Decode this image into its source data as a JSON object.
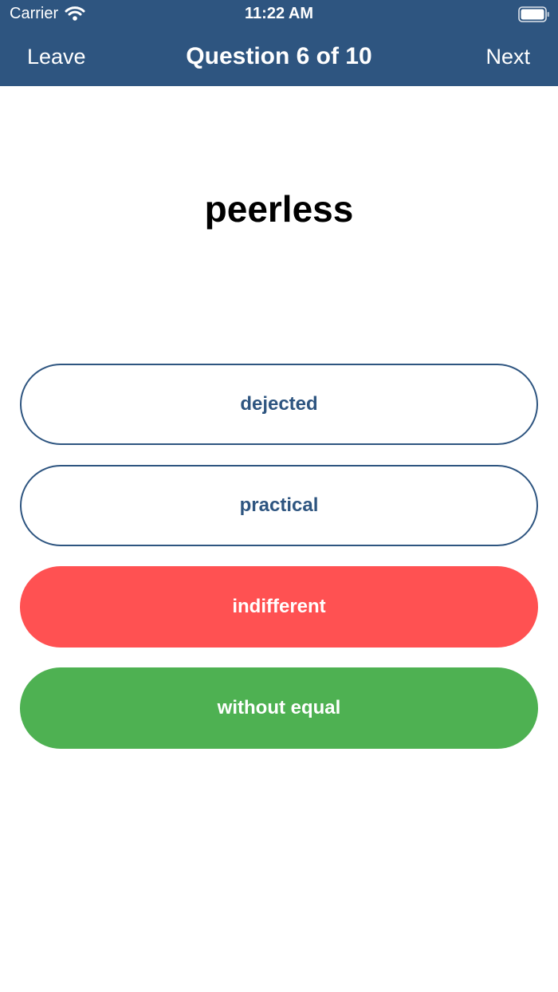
{
  "status_bar": {
    "carrier": "Carrier",
    "time": "11:22 AM",
    "wifi_icon": "wifi-icon",
    "battery_icon": "battery-icon"
  },
  "nav": {
    "left_label": "Leave",
    "title": "Question 6 of 10",
    "right_label": "Next"
  },
  "question": {
    "word": "peerless"
  },
  "answers": [
    {
      "label": "dejected",
      "state": "neutral"
    },
    {
      "label": "practical",
      "state": "neutral"
    },
    {
      "label": "indifferent",
      "state": "wrong"
    },
    {
      "label": "without equal",
      "state": "correct"
    }
  ],
  "colors": {
    "header": "#2e5580",
    "accent_text": "#2e5580",
    "wrong": "#ff5152",
    "correct": "#4eb152",
    "background": "#ffffff"
  }
}
